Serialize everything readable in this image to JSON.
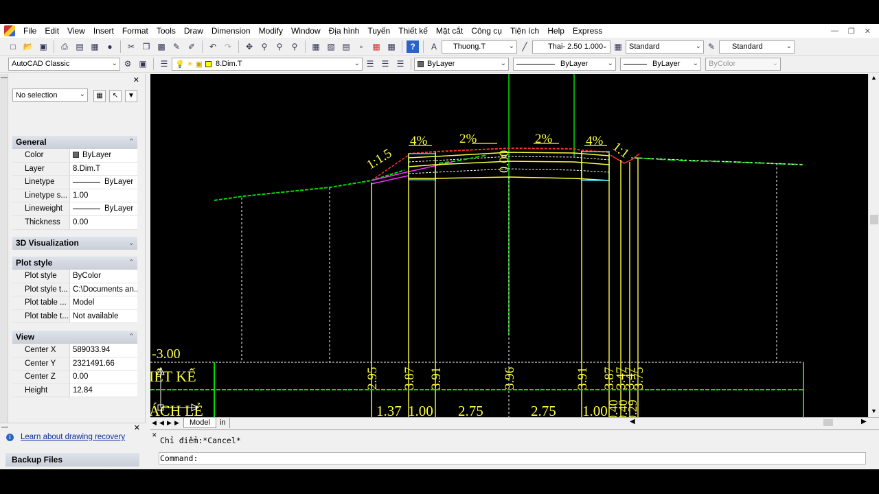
{
  "menubar": {
    "items": [
      "File",
      "Edit",
      "View",
      "Insert",
      "Format",
      "Tools",
      "Draw",
      "Dimension",
      "Modify",
      "Window",
      "Địa hình",
      "Tuyến",
      "Thiết kế",
      "Mặt cắt",
      "Công cụ",
      "Tiện ích",
      "Help",
      "Express"
    ]
  },
  "toolbar": {
    "text_style": "Thuong.T",
    "dim_style": "Thai- 2.50  1.000",
    "table_style": "Standard",
    "multileader_style": "Standard",
    "workspace": "AutoCAD Classic",
    "layer": "8.Dim.T",
    "color": "ByLayer",
    "linetype": "ByLayer",
    "lineweight": "ByLayer",
    "plotstyle": "ByColor"
  },
  "properties": {
    "selection": "No selection",
    "general": {
      "title": "General",
      "rows": [
        {
          "name": "Color",
          "value": "ByLayer"
        },
        {
          "name": "Layer",
          "value": "8.Dim.T"
        },
        {
          "name": "Linetype",
          "value": "ByLayer"
        },
        {
          "name": "Linetype s...",
          "value": "1.00"
        },
        {
          "name": "Lineweight",
          "value": "ByLayer"
        },
        {
          "name": "Thickness",
          "value": "0.00"
        }
      ]
    },
    "viz": {
      "title": "3D Visualization"
    },
    "plot": {
      "title": "Plot style",
      "rows": [
        {
          "name": "Plot style",
          "value": "ByColor"
        },
        {
          "name": "Plot style t...",
          "value": "C:\\Documents an..."
        },
        {
          "name": "Plot table ...",
          "value": "Model"
        },
        {
          "name": "Plot table t...",
          "value": "Not available"
        }
      ]
    },
    "view": {
      "title": "View",
      "rows": [
        {
          "name": "Center X",
          "value": "589033.94"
        },
        {
          "name": "Center Y",
          "value": "2321491.66"
        },
        {
          "name": "Center Z",
          "value": "0.00"
        },
        {
          "name": "Height",
          "value": "12.84"
        }
      ]
    }
  },
  "recovery": {
    "link": "Learn about drawing recovery",
    "backup": "Backup Files"
  },
  "drawing": {
    "slope_left": "1:1.5",
    "slope_right": "1:1",
    "grade_4_left": "4%",
    "grade_2_left": "2%",
    "center_elev": "0.00",
    "grade_2_right": "2%",
    "grade_4_right": "4%",
    "datum": "-3.00",
    "row1_label": "IẾT KẾ",
    "row2_label": "ÁCH LẺ",
    "design_elevs": [
      "2.95",
      "3.87",
      "3.91",
      "3.96",
      "3.91",
      "3.87",
      "3.47",
      "3.47",
      "3.75"
    ],
    "distances": [
      "1.37",
      "1.00",
      "2.75",
      "2.75",
      "1.00"
    ],
    "small_dists": [
      "0.40",
      "0.40",
      "0.29"
    ]
  },
  "tabs": {
    "model": "Model",
    "layout": "in"
  },
  "command": {
    "history": "Chỉ điểm:*Cancel*",
    "prompt": "Command:"
  }
}
